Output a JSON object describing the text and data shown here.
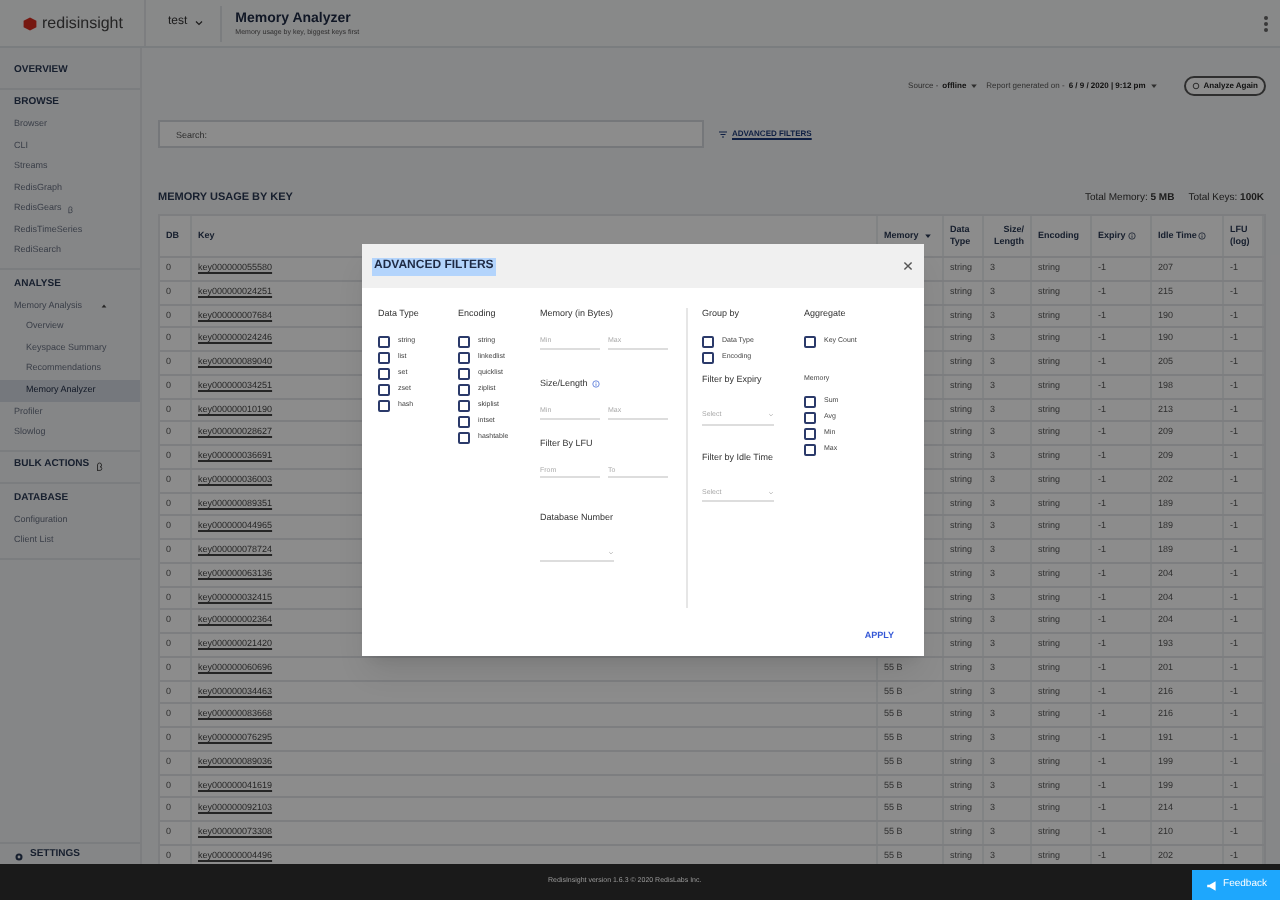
{
  "header": {
    "logo": "redisinsight",
    "database": "test",
    "title": "Memory Analyzer",
    "subtitle": "Memory usage by key, biggest keys first"
  },
  "sidebar": {
    "sections": [
      {
        "title": "OVERVIEW",
        "badge_icon": false
      },
      {
        "title": "BROWSE",
        "badge_icon": false,
        "items": [
          {
            "label": "Browser",
            "selected": false,
            "badge_icon": false
          },
          {
            "label": "CLI",
            "selected": false,
            "badge_icon": false
          },
          {
            "label": "Streams",
            "selected": false,
            "badge_icon": false
          },
          {
            "label": "RedisGraph",
            "selected": false,
            "badge_icon": false
          },
          {
            "label": "RedisGears",
            "selected": false,
            "badge_icon": true
          },
          {
            "label": "RedisTimeSeries",
            "selected": false,
            "badge_icon": false
          },
          {
            "label": "RediSearch",
            "selected": false,
            "badge_icon": false
          }
        ]
      },
      {
        "title": "ANALYSE",
        "badge_icon": false,
        "items": [
          {
            "label": "Memory Analysis",
            "selected": false,
            "badge_icon": false,
            "expanded": true,
            "children": [
              {
                "label": "Overview",
                "selected": false
              },
              {
                "label": "Keyspace Summary",
                "selected": false
              },
              {
                "label": "Recommendations",
                "selected": false
              },
              {
                "label": "Memory Analyzer",
                "selected": true
              }
            ]
          },
          {
            "label": "Profiler",
            "selected": false,
            "badge_icon": false
          },
          {
            "label": "Slowlog",
            "selected": false,
            "badge_icon": false
          }
        ]
      },
      {
        "title": "BULK ACTIONS",
        "badge_icon": true
      },
      {
        "title": "DATABASE",
        "badge_icon": false,
        "items": [
          {
            "label": "Configuration",
            "selected": false,
            "badge_icon": false
          },
          {
            "label": "Client List",
            "selected": false,
            "badge_icon": false
          }
        ]
      }
    ],
    "settings": "SETTINGS"
  },
  "toolbar": {
    "source_label": "Source - ",
    "source": "offline",
    "report_label": "Report generated on - ",
    "report": "6 / 9 / 2020 | 9:12 pm",
    "analyze_button": "Analyze Again"
  },
  "search": {
    "placeholder": "Search:"
  },
  "advanced_filters_link": "ADVANCED FILTERS",
  "table": {
    "title": "MEMORY USAGE BY KEY",
    "total_memory_label": "Total Memory: ",
    "total_memory": "5 MB",
    "total_keys_label": "Total Keys: ",
    "total_keys": "100K",
    "columns": [
      {
        "label": "DB",
        "kind": "plain"
      },
      {
        "label": "Key",
        "kind": "plain"
      },
      {
        "label": "Memory",
        "kind": "sorted"
      },
      {
        "label": "Data Type",
        "kind": "plain"
      },
      {
        "label": "Size/ Length",
        "kind": "plain"
      },
      {
        "label": "Encoding",
        "kind": "plain"
      },
      {
        "label": "Expiry",
        "kind": "info"
      },
      {
        "label": "Idle Time",
        "kind": "info"
      },
      {
        "label": "LFU (log)",
        "kind": "plain"
      }
    ],
    "rows": [
      {
        "db": "0",
        "key": "key000000055580",
        "data_type": "string",
        "size": "3",
        "encoding": "string",
        "expiry": "-1",
        "idle": "207",
        "lfu": "-1"
      },
      {
        "db": "0",
        "key": "key000000024251",
        "data_type": "string",
        "size": "3",
        "encoding": "string",
        "expiry": "-1",
        "idle": "215",
        "lfu": "-1"
      },
      {
        "db": "0",
        "key": "key000000007684",
        "data_type": "string",
        "size": "3",
        "encoding": "string",
        "expiry": "-1",
        "idle": "190",
        "lfu": "-1"
      },
      {
        "db": "0",
        "key": "key000000024246",
        "data_type": "string",
        "size": "3",
        "encoding": "string",
        "expiry": "-1",
        "idle": "190",
        "lfu": "-1"
      },
      {
        "db": "0",
        "key": "key000000089040",
        "data_type": "string",
        "size": "3",
        "encoding": "string",
        "expiry": "-1",
        "idle": "205",
        "lfu": "-1"
      },
      {
        "db": "0",
        "key": "key000000034251",
        "data_type": "string",
        "size": "3",
        "encoding": "string",
        "expiry": "-1",
        "idle": "198",
        "lfu": "-1"
      },
      {
        "db": "0",
        "key": "key000000010190",
        "data_type": "string",
        "size": "3",
        "encoding": "string",
        "expiry": "-1",
        "idle": "213",
        "lfu": "-1"
      },
      {
        "db": "0",
        "key": "key000000028627",
        "data_type": "string",
        "size": "3",
        "encoding": "string",
        "expiry": "-1",
        "idle": "209",
        "lfu": "-1"
      },
      {
        "db": "0",
        "key": "key000000036691",
        "data_type": "string",
        "size": "3",
        "encoding": "string",
        "expiry": "-1",
        "idle": "209",
        "lfu": "-1"
      },
      {
        "db": "0",
        "key": "key000000036003",
        "data_type": "string",
        "size": "3",
        "encoding": "string",
        "expiry": "-1",
        "idle": "202",
        "lfu": "-1"
      },
      {
        "db": "0",
        "key": "key000000089351",
        "data_type": "string",
        "size": "3",
        "encoding": "string",
        "expiry": "-1",
        "idle": "189",
        "lfu": "-1"
      },
      {
        "db": "0",
        "key": "key000000044965",
        "data_type": "string",
        "size": "3",
        "encoding": "string",
        "expiry": "-1",
        "idle": "189",
        "lfu": "-1"
      },
      {
        "db": "0",
        "key": "key000000078724",
        "data_type": "string",
        "size": "3",
        "encoding": "string",
        "expiry": "-1",
        "idle": "189",
        "lfu": "-1"
      },
      {
        "db": "0",
        "key": "key000000063136",
        "data_type": "string",
        "size": "3",
        "encoding": "string",
        "expiry": "-1",
        "idle": "204",
        "lfu": "-1"
      },
      {
        "db": "0",
        "key": "key000000032415",
        "data_type": "string",
        "size": "3",
        "encoding": "string",
        "expiry": "-1",
        "idle": "204",
        "lfu": "-1"
      },
      {
        "db": "0",
        "key": "key000000002364",
        "data_type": "string",
        "size": "3",
        "encoding": "string",
        "expiry": "-1",
        "idle": "204",
        "lfu": "-1"
      },
      {
        "db": "0",
        "key": "key000000021420",
        "data_type": "string",
        "size": "3",
        "encoding": "string",
        "expiry": "-1",
        "idle": "193",
        "lfu": "-1"
      },
      {
        "db": "0",
        "key": "key000000060696",
        "memory": "55 B",
        "data_type": "string",
        "size": "3",
        "encoding": "string",
        "expiry": "-1",
        "idle": "201",
        "lfu": "-1"
      },
      {
        "db": "0",
        "key": "key000000034463",
        "memory": "55 B",
        "data_type": "string",
        "size": "3",
        "encoding": "string",
        "expiry": "-1",
        "idle": "216",
        "lfu": "-1"
      },
      {
        "db": "0",
        "key": "key000000083668",
        "memory": "55 B",
        "data_type": "string",
        "size": "3",
        "encoding": "string",
        "expiry": "-1",
        "idle": "216",
        "lfu": "-1"
      },
      {
        "db": "0",
        "key": "key000000076295",
        "memory": "55 B",
        "data_type": "string",
        "size": "3",
        "encoding": "string",
        "expiry": "-1",
        "idle": "191",
        "lfu": "-1"
      },
      {
        "db": "0",
        "key": "key000000089036",
        "memory": "55 B",
        "data_type": "string",
        "size": "3",
        "encoding": "string",
        "expiry": "-1",
        "idle": "199",
        "lfu": "-1"
      },
      {
        "db": "0",
        "key": "key000000041619",
        "memory": "55 B",
        "data_type": "string",
        "size": "3",
        "encoding": "string",
        "expiry": "-1",
        "idle": "199",
        "lfu": "-1"
      },
      {
        "db": "0",
        "key": "key000000092103",
        "memory": "55 B",
        "data_type": "string",
        "size": "3",
        "encoding": "string",
        "expiry": "-1",
        "idle": "214",
        "lfu": "-1"
      },
      {
        "db": "0",
        "key": "key000000073308",
        "memory": "55 B",
        "data_type": "string",
        "size": "3",
        "encoding": "string",
        "expiry": "-1",
        "idle": "210",
        "lfu": "-1"
      },
      {
        "db": "0",
        "key": "key000000004496",
        "memory": "55 B",
        "data_type": "string",
        "size": "3",
        "encoding": "string",
        "expiry": "-1",
        "idle": "202",
        "lfu": "-1"
      }
    ]
  },
  "modal": {
    "title": "ADVANCED FILTERS",
    "title_highlighted": true,
    "data_type": {
      "label": "Data Type",
      "options": [
        {
          "label": "string",
          "checked": false
        },
        {
          "label": "list",
          "checked": false
        },
        {
          "label": "set",
          "checked": false
        },
        {
          "label": "zset",
          "checked": false
        },
        {
          "label": "hash",
          "checked": false
        }
      ]
    },
    "encoding": {
      "label": "Encoding",
      "options": [
        {
          "label": "string",
          "checked": false
        },
        {
          "label": "linkedlist",
          "checked": false
        },
        {
          "label": "quicklist",
          "checked": false
        },
        {
          "label": "ziplist",
          "checked": false
        },
        {
          "label": "skiplist",
          "checked": false
        },
        {
          "label": "intset",
          "checked": false
        },
        {
          "label": "hashtable",
          "checked": false
        }
      ]
    },
    "memory_bytes": {
      "label": "Memory (in Bytes)",
      "min_placeholder": "Min",
      "max_placeholder": "Max"
    },
    "size_length": {
      "label": "Size/Length",
      "min_placeholder": "Min",
      "max_placeholder": "Max"
    },
    "lfu": {
      "label": "Filter By LFU",
      "from_placeholder": "From",
      "to_placeholder": "To"
    },
    "database_number": {
      "label": "Database Number"
    },
    "group_by": {
      "label": "Group by",
      "options": [
        {
          "label": "Data Type",
          "checked": false
        },
        {
          "label": "Encoding",
          "checked": false
        }
      ]
    },
    "expiry": {
      "label": "Filter by Expiry",
      "placeholder": "Select"
    },
    "idle_time": {
      "label": "Filter by Idle Time",
      "placeholder": "Select"
    },
    "aggregate": {
      "label": "Aggregate",
      "options": [
        {
          "label": "Key Count",
          "checked": false
        }
      ]
    },
    "memory": {
      "label": "Memory",
      "options": [
        {
          "label": "Sum",
          "checked": false
        },
        {
          "label": "Avg",
          "checked": false
        },
        {
          "label": "Min",
          "checked": false
        },
        {
          "label": "Max",
          "checked": false
        }
      ]
    },
    "apply_button": "APPLY"
  },
  "footer": {
    "text": "RedisInsight version 1.6.3 © 2020 RedisLabs Inc.",
    "feedback_button": "Feedback"
  }
}
